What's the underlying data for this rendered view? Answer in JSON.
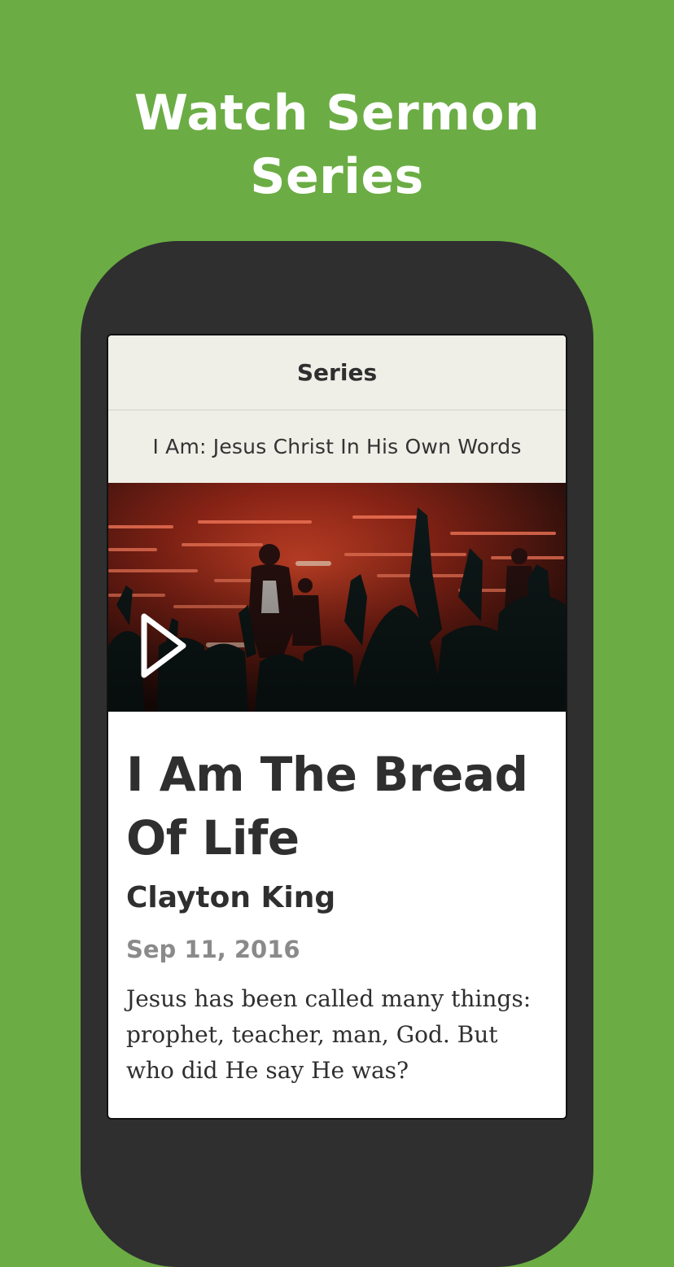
{
  "promo": {
    "title_line1": "Watch Sermon",
    "title_line2": "Series"
  },
  "app": {
    "nav_title": "Series",
    "series_name": "I Am: Jesus Christ In His Own Words"
  },
  "sermon": {
    "title": "I Am The Bread Of Life",
    "speaker": "Clayton King",
    "date": "Sep 11, 2016",
    "description": "Jesus has been called many things: prophet, teacher, man, God. But who did He say He was?"
  },
  "media": {
    "image_subject": "worship-concert-stage-photo",
    "play_icon": "play-icon"
  },
  "colors": {
    "background": "#6bad44",
    "phone": "#2f2f2f",
    "header_bg": "#efeee7",
    "text": "#2f2f2f",
    "muted": "#8a8a8a"
  }
}
